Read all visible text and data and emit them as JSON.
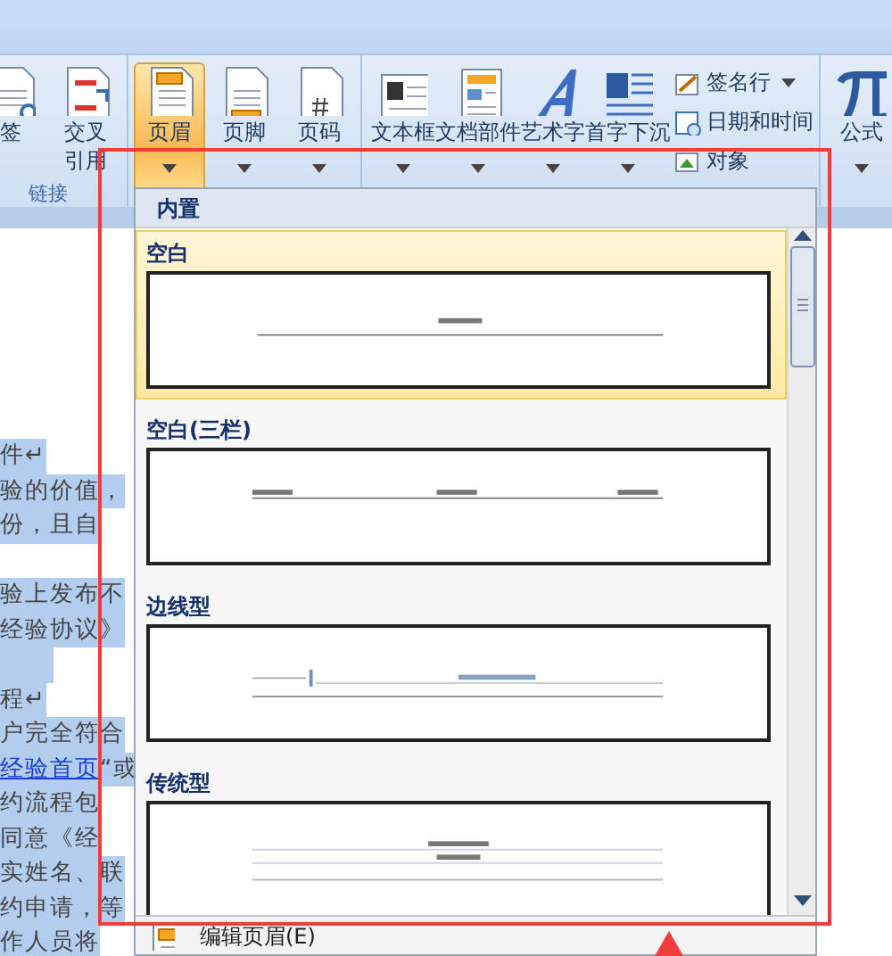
{
  "ribbon": {
    "groups": [
      {
        "label": "链接",
        "buttons": [
          {
            "lines": [
              "签"
            ],
            "kind": "bookmark",
            "dropdown": false,
            "selected": false
          },
          {
            "lines": [
              "交叉",
              "引用"
            ],
            "kind": "crossref",
            "dropdown": false,
            "selected": false
          }
        ]
      },
      {
        "buttons": [
          {
            "lines": [
              "页眉"
            ],
            "kind": "header",
            "dropdown": true,
            "selected": true
          },
          {
            "lines": [
              "页脚"
            ],
            "kind": "footer",
            "dropdown": true,
            "selected": false
          },
          {
            "lines": [
              "页码"
            ],
            "kind": "pagenum",
            "dropdown": true,
            "selected": false
          }
        ]
      },
      {
        "buttons": [
          {
            "lines": [
              "文本框"
            ],
            "kind": "textbox",
            "dropdown": true,
            "selected": false
          },
          {
            "lines": [
              "文档部件"
            ],
            "kind": "parts",
            "dropdown": true,
            "selected": false
          },
          {
            "lines": [
              "艺术字"
            ],
            "kind": "wordart",
            "dropdown": true,
            "selected": false
          },
          {
            "lines": [
              "首字下沉"
            ],
            "kind": "dropcap",
            "dropdown": true,
            "selected": false
          }
        ],
        "small_buttons": [
          {
            "label": "签名行",
            "kind": "signature",
            "dropdown": true
          },
          {
            "label": "日期和时间",
            "kind": "date",
            "dropdown": false
          },
          {
            "label": "对象",
            "kind": "object",
            "dropdown": false
          }
        ]
      },
      {
        "buttons": [
          {
            "lines": [
              "公式"
            ],
            "kind": "formula",
            "dropdown": true,
            "selected": false
          }
        ]
      }
    ]
  },
  "document": {
    "lines": [
      {
        "text": "件↵",
        "highlighted": true
      },
      {
        "text": "验的价值，",
        "highlighted": true
      },
      {
        "text": "份，且自",
        "highlighted": true
      },
      {
        "highlighted": false
      },
      {
        "text": "验上发布不",
        "highlighted": true
      },
      {
        "text": "经验协议》",
        "highlighted": true
      },
      {
        "highlighted": true
      },
      {
        "text": "程↵",
        "highlighted": true
      },
      {
        "text": "户完全符合",
        "highlighted": true
      },
      {
        "link": "经验首页",
        "text": "“或",
        "highlighted": true
      },
      {
        "text": "约流程包",
        "highlighted": true
      },
      {
        "text": "同意《经",
        "highlighted": true
      },
      {
        "text": "实姓名、联",
        "highlighted": true
      },
      {
        "text": "约申请，等",
        "highlighted": true
      },
      {
        "text": "作人员将",
        "highlighted": true
      }
    ]
  },
  "header_menu": {
    "section": "内置",
    "items": [
      {
        "title": "空白",
        "kind": "blank",
        "selected": true
      },
      {
        "title": "空白(三栏)",
        "kind": "three",
        "selected": false
      },
      {
        "title": "边线型",
        "kind": "sideline",
        "selected": false
      },
      {
        "title": "传统型",
        "kind": "traditional",
        "selected": false
      }
    ],
    "footer_action": "编辑页眉(E)"
  }
}
